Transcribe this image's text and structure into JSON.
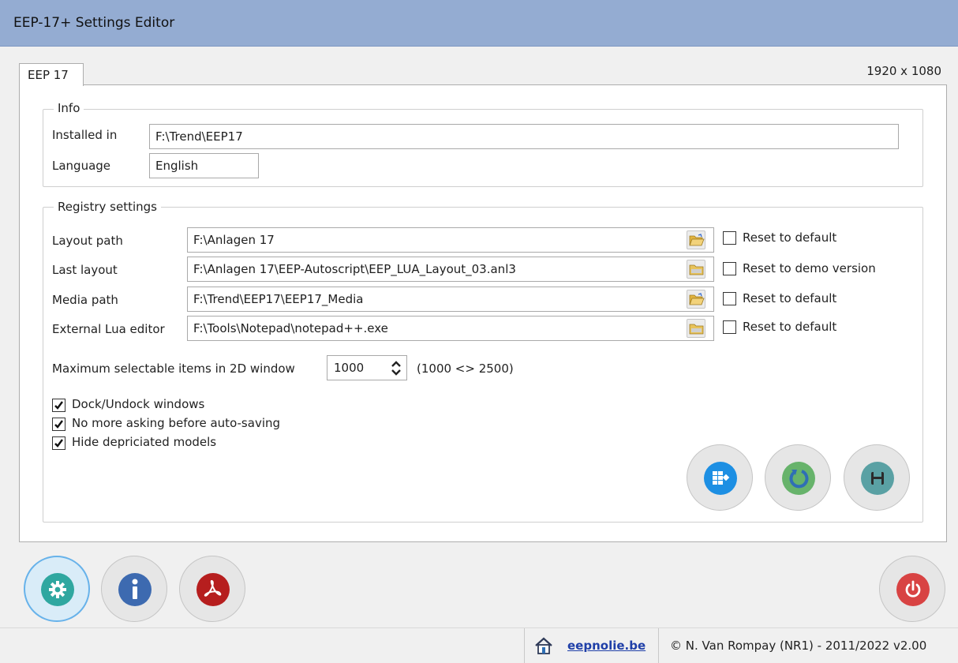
{
  "window": {
    "title": "EEP-17+ Settings Editor"
  },
  "tab": {
    "label": "EEP 17"
  },
  "resolution": "1920 x 1080",
  "info": {
    "legend": "Info",
    "installed_label": "Installed in",
    "installed_value": "F:\\Trend\\EEP17",
    "language_label": "Language",
    "language_value": "English"
  },
  "registry": {
    "legend": "Registry settings",
    "rows": [
      {
        "label": "Layout path",
        "value": "F:\\Anlagen 17",
        "reset": "Reset to default",
        "checked": false,
        "icon": "folder-open-icon"
      },
      {
        "label": "Last layout",
        "value": "F:\\Anlagen 17\\EEP-Autoscript\\EEP_LUA_Layout_03.anl3",
        "reset": "Reset to demo version",
        "checked": false,
        "icon": "folder-icon"
      },
      {
        "label": "Media path",
        "value": "F:\\Trend\\EEP17\\EEP17_Media",
        "reset": "Reset to default",
        "checked": false,
        "icon": "folder-open-icon"
      },
      {
        "label": "External Lua editor",
        "value": "F:\\Tools\\Notepad\\notepad++.exe",
        "reset": "Reset to default",
        "checked": false,
        "icon": "folder-icon"
      }
    ],
    "max_items_label": "Maximum selectable items in 2D window",
    "max_items_value": "1000",
    "max_items_range": "(1000 <> 2500)",
    "options": [
      {
        "label": "Dock/Undock windows",
        "checked": true
      },
      {
        "label": "No more asking before auto-saving",
        "checked": true
      },
      {
        "label": "Hide depriciated models",
        "checked": true
      }
    ]
  },
  "action_buttons": [
    {
      "icon": "windows-logo-icon",
      "color": "#1d8fe3"
    },
    {
      "icon": "refresh-icon",
      "color": "#67b36b"
    },
    {
      "icon": "floppy-disk-icon",
      "color": "#5aa1a4"
    }
  ],
  "nav_buttons": [
    {
      "icon": "gear-icon",
      "color": "#2fa7a0"
    },
    {
      "icon": "info-icon",
      "color": "#3d6ab0"
    },
    {
      "icon": "pdf-icon",
      "color": "#b61e1e"
    }
  ],
  "power_button": {
    "icon": "power-icon",
    "color": "#d84343"
  },
  "status": {
    "link": "eepnolie.be",
    "copyright": "© N. Van Rompay (NR1) - 2011/2022 v2.00"
  }
}
